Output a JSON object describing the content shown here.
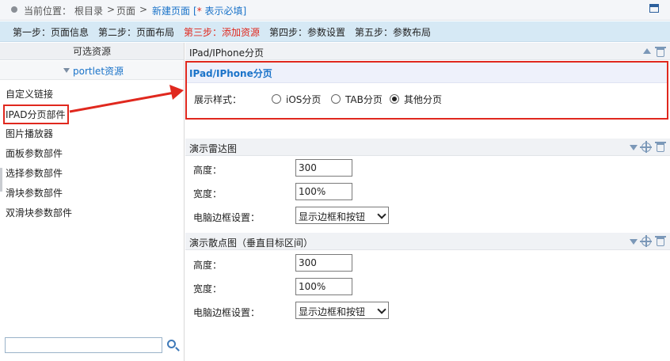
{
  "header": {
    "location_label": "当前位置：",
    "crumbs": [
      "根目录",
      "页面"
    ],
    "separator": ">",
    "current": "新建页面",
    "required_prefix": "[",
    "required_star": "*",
    "required_text": " 表示必填]"
  },
  "steps": [
    {
      "label": "第一步：页面信息",
      "active": false
    },
    {
      "label": "第二步：页面布局",
      "active": false
    },
    {
      "label": "第三步：添加资源",
      "active": true
    },
    {
      "label": "第四步：参数设置",
      "active": false
    },
    {
      "label": "第五步：参数布局",
      "active": false
    }
  ],
  "left_panel": {
    "title": "可选资源",
    "tree_root": "portlet资源",
    "components": [
      "自定义链接",
      "IPAD分页部件",
      "图片播放器",
      "面板参数部件",
      "选择参数部件",
      "滑块参数部件",
      "双滑块参数部件"
    ],
    "search_value": ""
  },
  "ipad_section": {
    "header_title": "IPad/IPhone分页",
    "box_title": "IPad/IPhone分页",
    "style_label": "展示样式：",
    "options": [
      "iOS分页",
      "TAB分页",
      "其他分页"
    ],
    "selected": "其他分页"
  },
  "radar_section": {
    "title": "演示雷达图",
    "height_label": "高度：",
    "height_value": "300",
    "width_label": "宽度：",
    "width_value": "100%",
    "border_label": "电脑边框设置：",
    "border_value": "显示边框和按钮"
  },
  "scatter_section": {
    "title": "演示散点图（垂直目标区间）",
    "height_label": "高度：",
    "height_value": "300",
    "width_label": "宽度：",
    "width_value": "100%",
    "border_label": "电脑边框设置：",
    "border_value": "显示边框和按钮"
  },
  "colors": {
    "accent_blue": "#1a73c9",
    "highlight_red": "#e0281e",
    "steps_bg": "#d6e9f5"
  }
}
